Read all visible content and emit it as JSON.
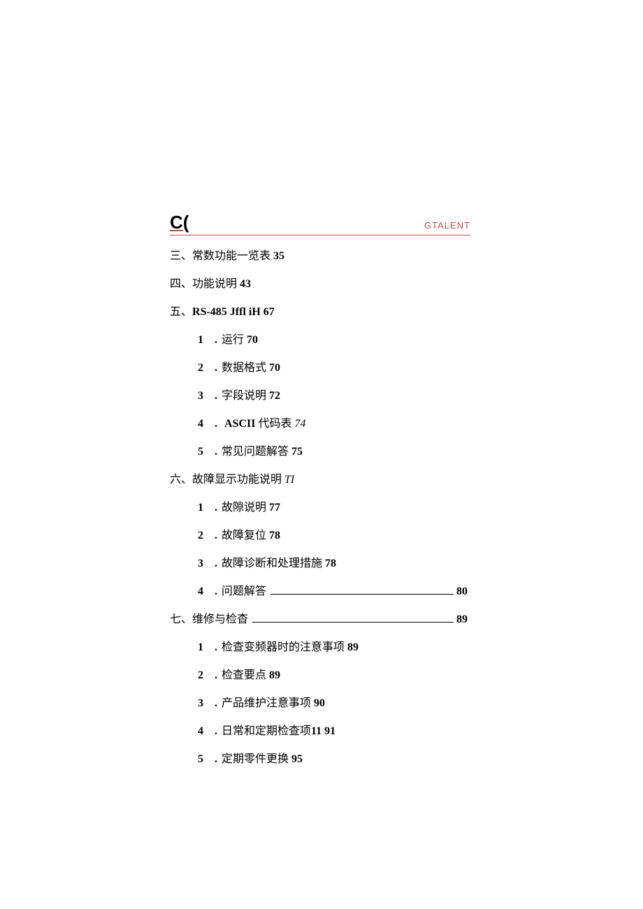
{
  "header": {
    "letter": "C(",
    "brand": "GTALENT"
  },
  "toc": {
    "s3": {
      "label": "三、常数功能一览表",
      "page": "35"
    },
    "s4": {
      "label": "四、功能说明",
      "page": "43"
    },
    "s5": {
      "label_prefix": "五、",
      "label_bold": "RS-485 Jffl iH 67",
      "items": [
        {
          "num": "1",
          "text": "运行",
          "page": "70"
        },
        {
          "num": "2",
          "text": "数据格式",
          "page": "70"
        },
        {
          "num": "3",
          "text": "字段说明",
          "page": "72"
        },
        {
          "num": "4",
          "text_bold": "ASCII",
          "text": " 代码表",
          "page_italic": "74"
        },
        {
          "num": "5",
          "text": "常见问题解答",
          "page": "75"
        }
      ]
    },
    "s6": {
      "label": "六、故障显示功能说明",
      "page_italic": "TI",
      "items": [
        {
          "num": "1",
          "text": "故隙说明",
          "page": "77"
        },
        {
          "num": "2",
          "text": "故障复位",
          "page": "78"
        },
        {
          "num": "3",
          "text": "故障诊断和处理措施",
          "page": "78"
        },
        {
          "num": "4",
          "text": "问题解答",
          "page_right": "80",
          "leader": true
        }
      ]
    },
    "s7": {
      "label": "七、维修与检杳",
      "page_right": "89",
      "leader": true,
      "items": [
        {
          "num": "1",
          "text": "检查变频器时的注意事项",
          "page": "89"
        },
        {
          "num": "2",
          "text": "检查要点",
          "page": "89"
        },
        {
          "num": "3",
          "text": "产品维护注意事项",
          "page": "90"
        },
        {
          "num": "4",
          "text": "日常和定期检查项",
          "page_inline_bold": "11 91"
        },
        {
          "num": "5",
          "text": "定期零件更换",
          "page": "95"
        }
      ]
    }
  }
}
